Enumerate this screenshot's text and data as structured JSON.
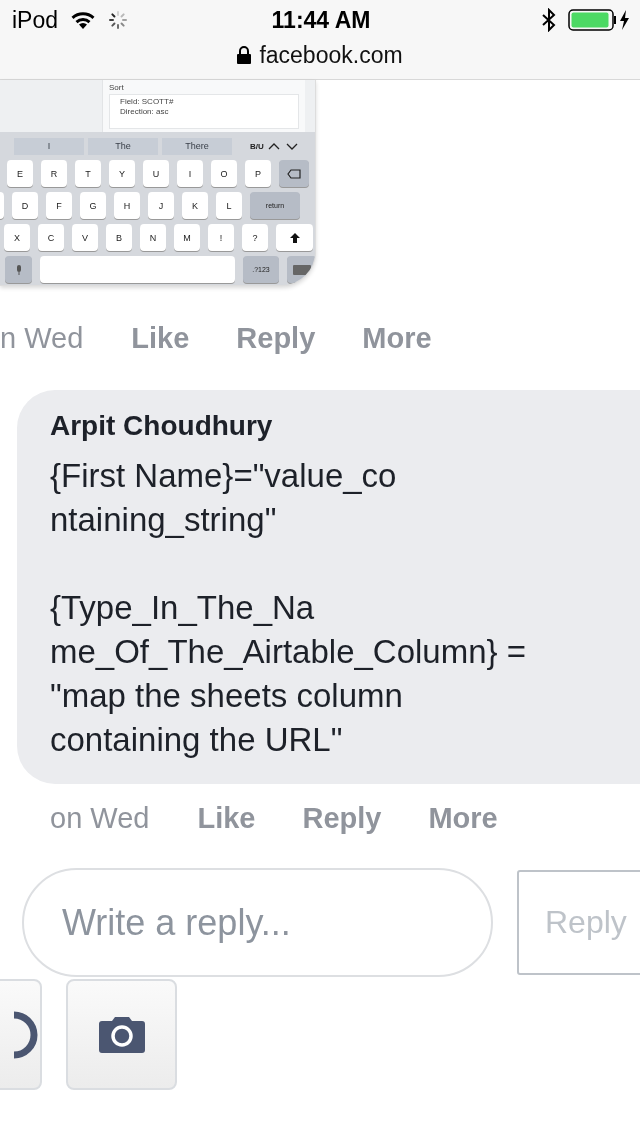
{
  "status_bar": {
    "carrier": "iPod",
    "time": "11:44 AM"
  },
  "address_bar": {
    "url": "facebook.com"
  },
  "attachment": {
    "panel": {
      "title": "Sort",
      "field": "Field: SCOTT#",
      "direction": "Direction: asc"
    },
    "suggestions": [
      {
        "label": "I"
      },
      {
        "label": "The"
      },
      {
        "label": "There"
      }
    ],
    "format_label": "B/U",
    "key_rows": [
      {
        "keys": [
          {
            "kind": "letter",
            "label": "E"
          },
          {
            "kind": "letter",
            "label": "R"
          },
          {
            "kind": "letter",
            "label": "T"
          },
          {
            "kind": "letter",
            "label": "Y"
          },
          {
            "kind": "letter",
            "label": "U"
          },
          {
            "kind": "letter",
            "label": "I"
          },
          {
            "kind": "letter",
            "label": "O"
          },
          {
            "kind": "letter",
            "label": "P"
          },
          {
            "kind": "delete"
          }
        ]
      },
      {
        "keys": [
          {
            "kind": "partial"
          },
          {
            "kind": "letter",
            "label": "D"
          },
          {
            "kind": "letter",
            "label": "F"
          },
          {
            "kind": "letter",
            "label": "G"
          },
          {
            "kind": "letter",
            "label": "H"
          },
          {
            "kind": "letter",
            "label": "J"
          },
          {
            "kind": "letter",
            "label": "K"
          },
          {
            "kind": "letter",
            "label": "L"
          },
          {
            "kind": "wide",
            "label": "return"
          }
        ]
      },
      {
        "keys": [
          {
            "kind": "letter",
            "label": "X"
          },
          {
            "kind": "letter",
            "label": "C"
          },
          {
            "kind": "letter",
            "label": "V"
          },
          {
            "kind": "letter",
            "label": "B"
          },
          {
            "kind": "letter",
            "label": "N"
          },
          {
            "kind": "letter",
            "label": "M"
          },
          {
            "kind": "letter",
            "label": "!"
          },
          {
            "kind": "letter",
            "label": "?"
          },
          {
            "kind": "shift"
          }
        ]
      },
      {
        "keys": [
          {
            "kind": "mic"
          },
          {
            "kind": "space"
          },
          {
            "kind": "action",
            "label": ".?123"
          },
          {
            "kind": "keyboard"
          }
        ]
      }
    ]
  },
  "first_actions": {
    "time": "n Wed",
    "buttons": [
      "Like",
      "Reply",
      "More"
    ]
  },
  "comment": {
    "author": "Arpit Choudhury",
    "paragraphs": [
      [
        "{First Name}=\"value_co",
        "ntaining_string\""
      ],
      [
        "{Type_In_The_Na",
        "me_Of_The_Airtable_Column} =",
        "\"map the sheets column",
        "containing the URL\""
      ]
    ]
  },
  "comment_actions": {
    "time": "on Wed",
    "buttons": [
      "Like",
      "Reply",
      "More"
    ]
  },
  "reply_box": {
    "placeholder": "Write a reply...",
    "button": "Reply"
  }
}
